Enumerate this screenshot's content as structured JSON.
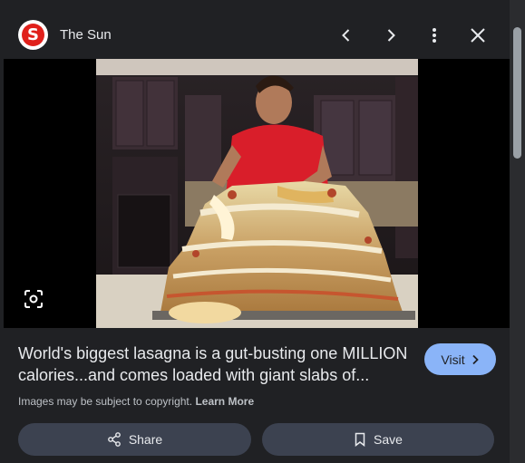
{
  "header": {
    "source_name": "The Sun",
    "logo_letter": "S",
    "brand_color": "#e0201b",
    "icons": [
      "chevron-left-icon",
      "chevron-right-icon",
      "more-vert-icon",
      "close-icon"
    ]
  },
  "image": {
    "lens_icon": "lens-icon"
  },
  "result": {
    "title_line1": "World's biggest lasagna is a gut-busting one MILLION",
    "title_line2": "calories...and comes loaded with giant slabs of...",
    "visit_label": "Visit",
    "copyright_text": "Images may be subject to copyright.",
    "learn_more": "Learn More",
    "accent": "#8ab4f8"
  },
  "actions": {
    "share_label": "Share",
    "save_label": "Save"
  }
}
